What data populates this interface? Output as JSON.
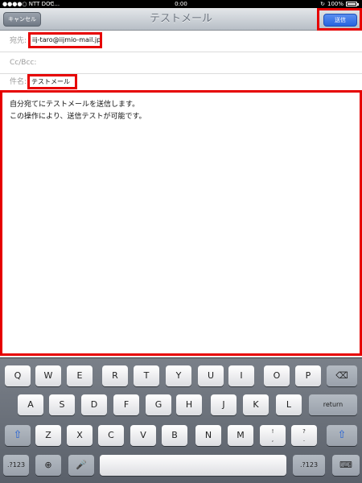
{
  "status_bar": {
    "carrier": "●●●●○ NTT DOC...",
    "time": "0:00",
    "battery": "100%"
  },
  "nav": {
    "title": "テストメール",
    "cancel_label": "キャンセル",
    "send_label": "送信"
  },
  "fields": {
    "to": {
      "label": "宛先:",
      "value": "iij-taro@iijmio-mail.jp"
    },
    "ccbcc": {
      "label": "Cc/Bcc:"
    },
    "subject": {
      "label": "件名:",
      "value": "テストメール"
    }
  },
  "body": {
    "line1": "自分宛てにテストメールを送信します。",
    "line2": "この操作により、送信テストが可能です。"
  },
  "keyboard": {
    "row1": [
      "Q",
      "W",
      "E",
      "R",
      "T",
      "Y",
      "U",
      "I",
      "O",
      "P"
    ],
    "row2": [
      "A",
      "S",
      "D",
      "F",
      "G",
      "H",
      "J",
      "K",
      "L"
    ],
    "row3": [
      "Z",
      "X",
      "C",
      "V",
      "B",
      "N",
      "M"
    ],
    "return_label": "return",
    "num_label": ".?123",
    "punct1_top": "!",
    "punct1_bottom": ",",
    "punct2_top": "?",
    "punct2_bottom": "."
  }
}
